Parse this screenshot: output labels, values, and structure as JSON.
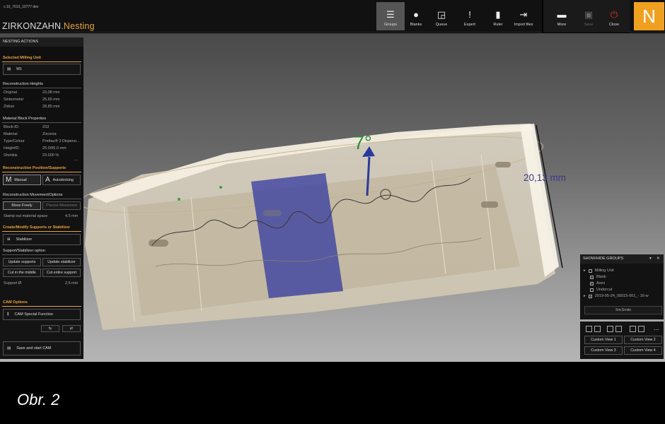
{
  "window": {
    "filename": "c:10_7013_10777 dev",
    "brand_main": "ZIRKONZAHN",
    "brand_accent": ".Nesting"
  },
  "toolbar": {
    "items": [
      {
        "label": "Groups",
        "icon": "menu-icon"
      },
      {
        "label": "Blanks",
        "icon": "blank-icon"
      },
      {
        "label": "Queue",
        "icon": "queue-icon"
      },
      {
        "label": "Expert",
        "icon": "exclamation-icon"
      },
      {
        "label": "Ruler",
        "icon": "ruler-icon"
      },
      {
        "label": "Import files",
        "icon": "import-icon"
      }
    ],
    "right_items": [
      {
        "label": "More",
        "icon": "more-icon"
      },
      {
        "label": "Save",
        "icon": "save-icon"
      },
      {
        "label": "Close",
        "icon": "power-icon"
      }
    ],
    "logo_letter": "N"
  },
  "viewport": {
    "angle_label": "7°",
    "dimension_label": "20,13 mm"
  },
  "left_panel": {
    "header": "NESTING ACTIONS",
    "selected_unit_title": "Selected Milling Unit",
    "selected_unit": "M1",
    "recon_heights_title": "Reconstruction Heights",
    "heights": [
      {
        "label": "Original",
        "value": "23,08 mm"
      },
      {
        "label": "Sintermetal",
        "value": "25,65 mm"
      },
      {
        "label": "Zirkon",
        "value": "28,85 mm"
      }
    ],
    "material_title": "Material Block Properties",
    "material": [
      {
        "label": "Block-ID:",
        "value": "233"
      },
      {
        "label": "Material",
        "value": "Zirconia"
      },
      {
        "label": "Type/Colour",
        "value": "Prettau® 3 Dispersi..."
      },
      {
        "label": "Height/D:",
        "value": "25.0/95.0 mm"
      },
      {
        "label": "Shrinkis",
        "value": "23.000 %"
      }
    ],
    "ellipsis": "...",
    "recon_pos_title": "Reconstruction Position/Supports",
    "manual_label": "Manual",
    "autodocking_label": "Autodocking",
    "movement_title": "Reconstruction Movement/Options",
    "move_freely": "Move Freely",
    "precise_movement": "Precise Movement",
    "stampout_label": "Stamp out material space",
    "stampout_value": "4,5 mm",
    "supports_title": "Create/Modify Supports or Stabilizer",
    "stabilizer_label": "Stabilizer",
    "support_option_title": "Support/Stabilizer option",
    "update_supports": "Update supports",
    "update_stabilizer": "Update stabilizer",
    "cut_middle": "Cut in the middle",
    "cut_entire": "Cut entire support",
    "support_d_label": "Support Ø",
    "support_d_value": "2,5 mm",
    "cam_title": "CAM Options",
    "cam_special": "CAM Special Function",
    "save_cam": "Save and start CAM"
  },
  "groups_panel": {
    "title": "SHOW/HIDE GROUPS",
    "items": [
      {
        "label": "Milling Unit",
        "checked": false
      },
      {
        "label": "Blank",
        "checked": true
      },
      {
        "label": "Axes",
        "checked": true
      },
      {
        "label": "Undercut",
        "checked": false
      },
      {
        "label": "2019-05-24_00015-001_- 16-w",
        "checked": true
      }
    ],
    "search_value": "3ricSmile"
  },
  "views_panel": {
    "more": "...",
    "views": [
      "Custom View 1",
      "Custom View 2",
      "Custom View 3",
      "Custom View 4"
    ]
  },
  "caption": "Obr. 2",
  "colors": {
    "accent": "#e8a33d",
    "logo": "#f0a020",
    "angle": "#2e8b3a",
    "dimension": "#3a3a8a",
    "close": "#e0302a"
  }
}
